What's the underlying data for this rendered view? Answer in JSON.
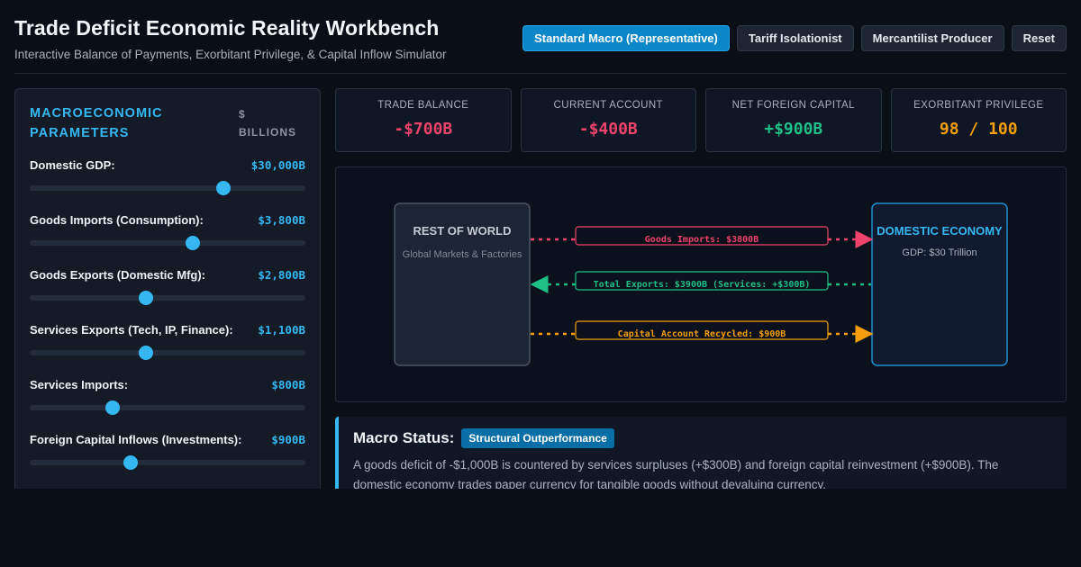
{
  "header": {
    "title": "Trade Deficit Economic Reality Workbench",
    "subtitle": "Interactive Balance of Payments, Exorbitant Privilege, & Capital Inflow Simulator",
    "scenarios": [
      {
        "label": "Standard Macro (Representative)",
        "active": true
      },
      {
        "label": "Tariff Isolationist",
        "active": false
      },
      {
        "label": "Mercantilist Producer",
        "active": false
      },
      {
        "label": "Reset",
        "active": false
      }
    ]
  },
  "params": {
    "title": "Macroeconomic Parameters",
    "unit": "$ Billions",
    "items": [
      {
        "label": "Domestic GDP:",
        "value": "$30,000B",
        "level": 0.703
      },
      {
        "label": "Goods Imports (Consumption):",
        "value": "$3,800B",
        "level": 0.59
      },
      {
        "label": "Goods Exports (Domestic Mfg):",
        "value": "$2,800B",
        "level": 0.42
      },
      {
        "label": "Services Exports (Tech, IP, Finance):",
        "value": "$1,100B",
        "level": 0.42
      },
      {
        "label": "Services Imports:",
        "value": "$800B",
        "level": 0.3
      },
      {
        "label": "Foreign Capital Inflows (Investments):",
        "value": "$900B",
        "level": 0.365
      }
    ]
  },
  "metrics": [
    {
      "label": "Trade Balance",
      "value": "-$700B",
      "color": "#f0436b"
    },
    {
      "label": "Current Account",
      "value": "-$400B",
      "color": "#f0436b"
    },
    {
      "label": "Net Foreign Capital",
      "value": "+$900B",
      "color": "#1fbf88"
    },
    {
      "label": "Exorbitant Privilege",
      "value": "98 / 100",
      "color": "#f59e0b"
    }
  ],
  "flow": {
    "rest_of_world": {
      "title": "REST OF WORLD",
      "subtitle": "Global Markets & Factories"
    },
    "domestic": {
      "title": "DOMESTIC ECONOMY",
      "subtitle": "GDP: $30 Trillion"
    },
    "flows": [
      {
        "label": "Goods Imports: $3800B",
        "color": "#f0436b",
        "direction": "to-domestic"
      },
      {
        "label": "Total Exports: $3900B (Services: +$300B)",
        "color": "#1fbf88",
        "direction": "to-world"
      },
      {
        "label": "Capital Account Recycled: $900B",
        "color": "#f59e0b",
        "direction": "to-domestic"
      }
    ]
  },
  "status": {
    "title": "Macro Status:",
    "badge": "Structural Outperformance",
    "text": "A goods deficit of -$1,000B is countered by services surpluses (+$300B) and foreign capital reinvestment (+$900B). The domestic economy trades paper currency for tangible goods without devaluing currency."
  }
}
